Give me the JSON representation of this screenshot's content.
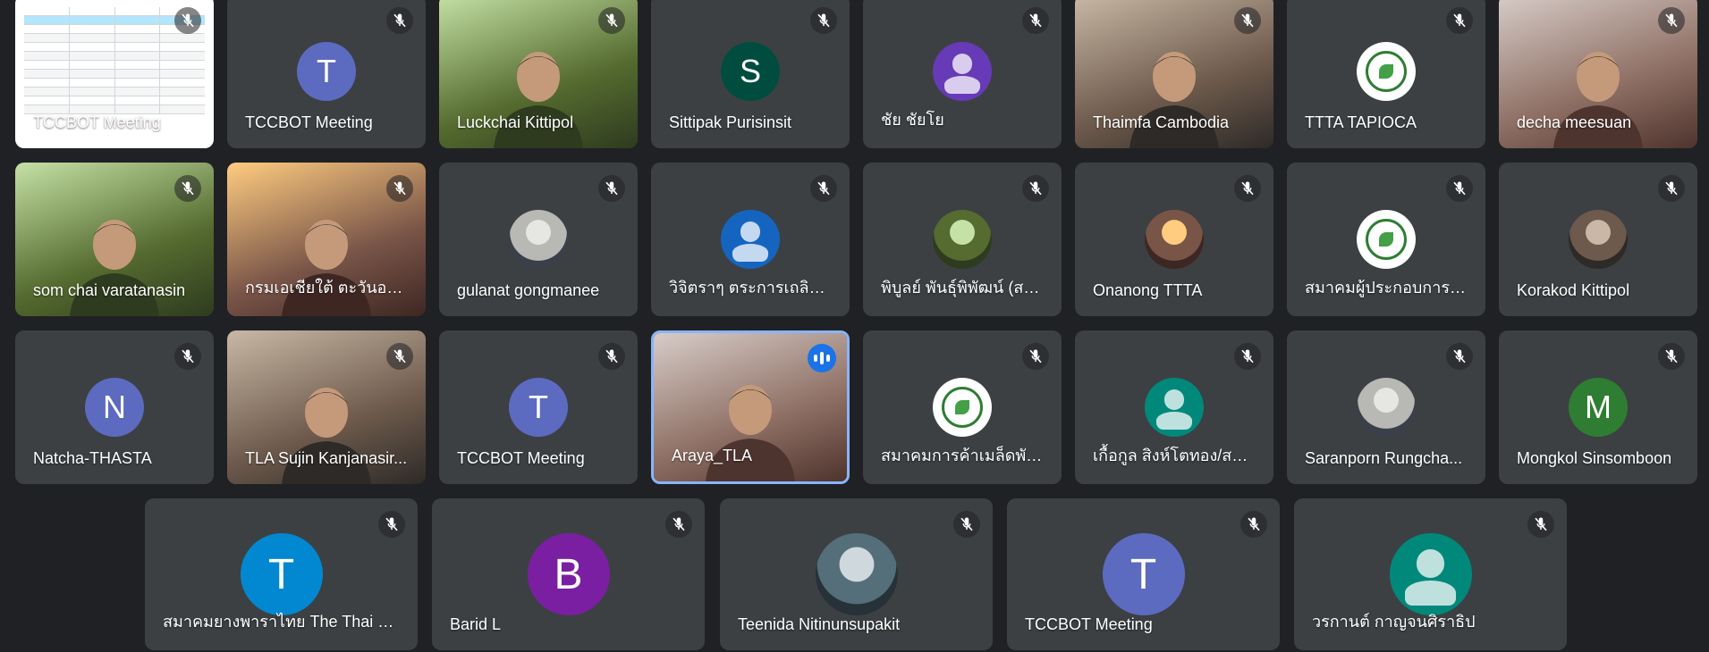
{
  "participants_row1": [
    {
      "name": "TCCBOT Meeting",
      "type": "screen"
    },
    {
      "name": "TCCBOT Meeting",
      "type": "letter",
      "letter": "T",
      "color": "#5c6bc0"
    },
    {
      "name": "Luckchai Kittipol",
      "type": "video"
    },
    {
      "name": "Sittipak Purisinsit",
      "type": "letter",
      "letter": "S",
      "color": "#004d40"
    },
    {
      "name": "ชัย ชัยโย",
      "type": "generic",
      "color": "#673ab7"
    },
    {
      "name": "Thaimfa Cambodia",
      "type": "video"
    },
    {
      "name": "TTTA TAPIOCA",
      "type": "logo"
    },
    {
      "name": "decha meesuan",
      "type": "video"
    }
  ],
  "participants_row2": [
    {
      "name": "som chai varatanasin",
      "type": "video"
    },
    {
      "name": "กรมเอเชียใต้ ตะวันออก...",
      "type": "video"
    },
    {
      "name": "gulanat gongmanee",
      "type": "photo"
    },
    {
      "name": "วิจิตราๆ ตระการเถลิงศั...",
      "type": "generic",
      "color": "#1565c0"
    },
    {
      "name": "พิบูลย์ พันธุ์พิพัฒน์ (สม...",
      "type": "photo"
    },
    {
      "name": "Onanong TTTA",
      "type": "photo"
    },
    {
      "name": "สมาคมผู้ประกอบการข้...",
      "type": "logo"
    },
    {
      "name": "Korakod Kittipol",
      "type": "photo"
    }
  ],
  "participants_row3": [
    {
      "name": "Natcha-THASTA",
      "type": "letter",
      "letter": "N",
      "color": "#5c6bc0"
    },
    {
      "name": "TLA Sujin Kanjanasir...",
      "type": "video"
    },
    {
      "name": "TCCBOT Meeting",
      "type": "letter",
      "letter": "T",
      "color": "#5c6bc0"
    },
    {
      "name": "Araya_TLA",
      "type": "video",
      "speaking": true
    },
    {
      "name": "สมาคมการค้าเมล็ดพัน...",
      "type": "logo"
    },
    {
      "name": "เกื้อกูล สิงห์โตทอง/สม...",
      "type": "generic",
      "color": "#00897b"
    },
    {
      "name": "Saranporn Rungcha...",
      "type": "photo"
    },
    {
      "name": "Mongkol Sinsomboon",
      "type": "letter",
      "letter": "M",
      "color": "#2e7d32"
    }
  ],
  "participants_row4": [
    {
      "name": "สมาคมยางพาราไทย The Thai Ru...",
      "type": "letter",
      "letter": "T",
      "color": "#0288d1"
    },
    {
      "name": "Barid L",
      "type": "letter",
      "letter": "B",
      "color": "#7b1fa2"
    },
    {
      "name": "Teenida Nitinunsupakit",
      "type": "photo"
    },
    {
      "name": "TCCBOT Meeting",
      "type": "letter",
      "letter": "T",
      "color": "#5c6bc0"
    },
    {
      "name": "วรกานต์ กาญจนศิราธิป",
      "type": "generic",
      "color": "#00897b"
    }
  ],
  "icons": {
    "muted": "mic-off-icon",
    "speaking": "audio-wave-icon",
    "screen": "present-screen-icon"
  }
}
